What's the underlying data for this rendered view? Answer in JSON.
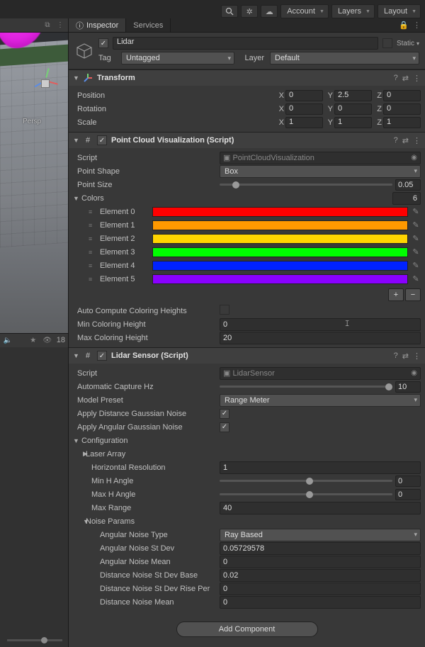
{
  "top_toolbar": {
    "account_label": "Account",
    "layers_label": "Layers",
    "layout_label": "Layout"
  },
  "scene": {
    "persp_label": "Persp",
    "layer_count": "18"
  },
  "tabs": {
    "inspector": "Inspector",
    "services": "Services"
  },
  "gameobject": {
    "enabled": true,
    "name": "Lidar",
    "static_label": "Static",
    "tag_label": "Tag",
    "tag_value": "Untagged",
    "layer_label": "Layer",
    "layer_value": "Default"
  },
  "transform": {
    "title": "Transform",
    "position_label": "Position",
    "rotation_label": "Rotation",
    "scale_label": "Scale",
    "position": {
      "x": "0",
      "y": "2.5",
      "z": "0"
    },
    "rotation": {
      "x": "0",
      "y": "0",
      "z": "0"
    },
    "scale": {
      "x": "1",
      "y": "1",
      "z": "1"
    }
  },
  "pcv": {
    "title": "Point Cloud Visualization (Script)",
    "script_label": "Script",
    "script_value": "PointCloudVisualization",
    "point_shape_label": "Point Shape",
    "point_shape_value": "Box",
    "point_size_label": "Point Size",
    "point_size_value": "0.05",
    "colors_label": "Colors",
    "colors_count": "6",
    "colors": [
      {
        "label": "Element 0",
        "hex": "#ff0000"
      },
      {
        "label": "Element 1",
        "hex": "#ff9900"
      },
      {
        "label": "Element 2",
        "hex": "#ffd400"
      },
      {
        "label": "Element 3",
        "hex": "#00ff00"
      },
      {
        "label": "Element 4",
        "hex": "#0022ff"
      },
      {
        "label": "Element 5",
        "hex": "#8a00ff"
      }
    ],
    "auto_compute_label": "Auto Compute Coloring Heights",
    "auto_compute_value": false,
    "min_h_label": "Min Coloring Height",
    "min_h_value": "0",
    "max_h_label": "Max Coloring Height",
    "max_h_value": "20"
  },
  "lidar": {
    "title": "Lidar Sensor (Script)",
    "script_label": "Script",
    "script_value": "LidarSensor",
    "capture_hz_label": "Automatic Capture Hz",
    "capture_hz_value": "10",
    "model_preset_label": "Model Preset",
    "model_preset_value": "Range Meter",
    "apply_dist_noise_label": "Apply Distance Gaussian Noise",
    "apply_dist_noise_value": true,
    "apply_ang_noise_label": "Apply Angular Gaussian Noise",
    "apply_ang_noise_value": true,
    "config_label": "Configuration",
    "laser_array_label": "Laser Array",
    "hres_label": "Horizontal Resolution",
    "hres_value": "1",
    "minh_label": "Min H Angle",
    "minh_value": "0",
    "maxh_label": "Max H Angle",
    "maxh_value": "0",
    "maxrange_label": "Max Range",
    "maxrange_value": "40",
    "noise_label": "Noise Params",
    "ang_type_label": "Angular Noise Type",
    "ang_type_value": "Ray Based",
    "ang_std_label": "Angular Noise St Dev",
    "ang_std_value": "0.05729578",
    "ang_mean_label": "Angular Noise Mean",
    "ang_mean_value": "0",
    "dist_std_base_label": "Distance Noise St Dev Base",
    "dist_std_base_value": "0.02",
    "dist_std_rise_label": "Distance Noise St Dev Rise Per",
    "dist_std_rise_value": "0",
    "dist_mean_label": "Distance Noise Mean",
    "dist_mean_value": "0"
  },
  "add_component_label": "Add Component",
  "axes": {
    "x": "X",
    "y": "Y",
    "z": "Z"
  }
}
